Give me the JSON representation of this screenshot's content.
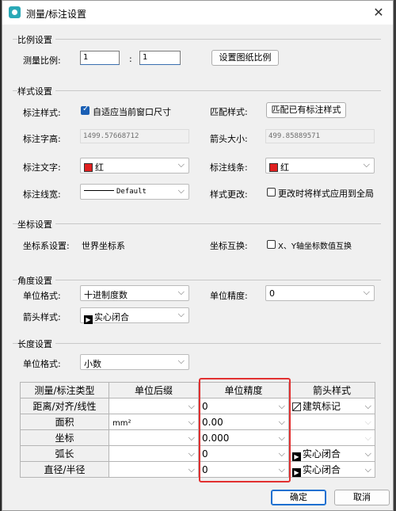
{
  "window": {
    "title": "测量/标注设置"
  },
  "scale_group": {
    "title": "比例设置",
    "label": "测量比例:",
    "left": "1",
    "sep": ":",
    "right": "1",
    "button": "设置图纸比例"
  },
  "style_group": {
    "title": "样式设置",
    "dim_style_label": "标注样式:",
    "auto_fit_label": "自适应当前窗口尺寸",
    "auto_fit_checked": true,
    "match_label": "匹配样式:",
    "match_button": "匹配已有标注样式",
    "text_height_label": "标注字高:",
    "text_height_value": "1499.57668712",
    "arrow_size_label": "箭头大小:",
    "arrow_size_value": "499.85889571",
    "text_color_label": "标注文字:",
    "text_color_value": "红",
    "line_color_label": "标注线条:",
    "line_color_value": "红",
    "line_width_label": "标注线宽:",
    "line_width_value": "Default",
    "style_change_label": "样式更改:",
    "apply_all_label": "更改时将样式应用到全局",
    "apply_all_checked": false,
    "red": "#e02020"
  },
  "coord_group": {
    "title": "坐标设置",
    "system_label": "坐标系设置:",
    "system_value": "世界坐标系",
    "swap_label": "坐标互换:",
    "swap_check_label": "X、Y轴坐标数值互换",
    "swap_checked": false
  },
  "angle_group": {
    "title": "角度设置",
    "unit_format_label": "单位格式:",
    "unit_format_value": "十进制度数",
    "precision_label": "单位精度:",
    "precision_value": "0",
    "arrow_style_label": "箭头样式:",
    "arrow_style_value": "实心闭合"
  },
  "length_group": {
    "title": "长度设置",
    "unit_format_label": "单位格式:",
    "unit_format_value": "小数",
    "table": {
      "headers": [
        "测量/标注类型",
        "单位后缀",
        "单位精度",
        "箭头样式"
      ],
      "rows": [
        {
          "type": "距离/对齐/线性",
          "suffix": "",
          "precision": "0",
          "arrow": "建筑标记",
          "arrow_icon": "architectural-tick"
        },
        {
          "type": "面积",
          "suffix": "mm²",
          "precision": "0.00",
          "arrow": "",
          "arrow_icon": ""
        },
        {
          "type": "坐标",
          "suffix": "",
          "precision": "0.000",
          "arrow": "",
          "arrow_icon": ""
        },
        {
          "type": "弧长",
          "suffix": "",
          "precision": "0",
          "arrow": "实心闭合",
          "arrow_icon": "closed-filled"
        },
        {
          "type": "直径/半径",
          "suffix": "",
          "precision": "0",
          "arrow": "实心闭合",
          "arrow_icon": "closed-filled"
        }
      ]
    }
  },
  "footer": {
    "ok": "确定",
    "cancel": "取消"
  },
  "highlight_color": "#e23030"
}
